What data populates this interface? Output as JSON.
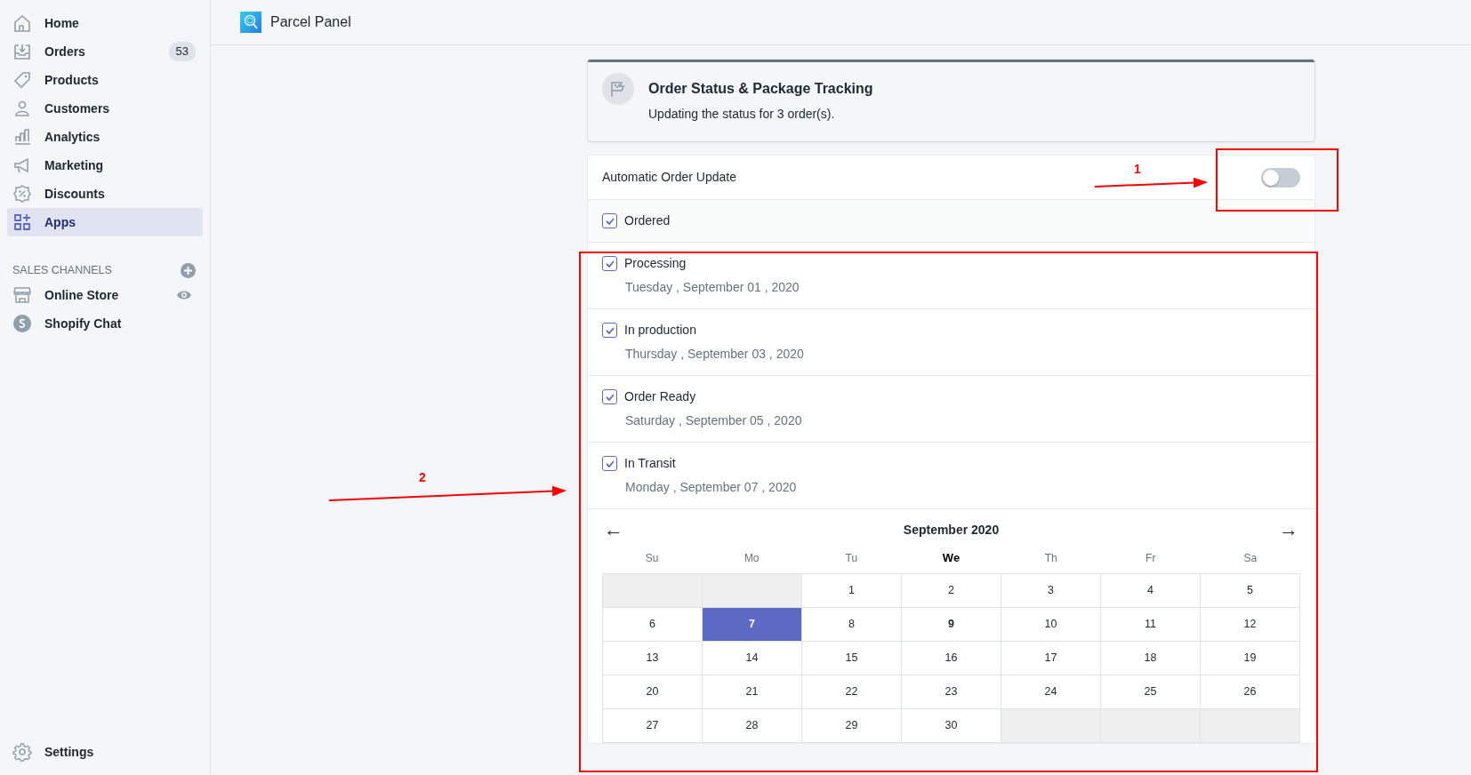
{
  "sidebar": {
    "items": [
      {
        "label": "Home",
        "selected": false
      },
      {
        "label": "Orders",
        "selected": false,
        "badge": "53"
      },
      {
        "label": "Products",
        "selected": false
      },
      {
        "label": "Customers",
        "selected": false
      },
      {
        "label": "Analytics",
        "selected": false
      },
      {
        "label": "Marketing",
        "selected": false
      },
      {
        "label": "Discounts",
        "selected": false
      },
      {
        "label": "Apps",
        "selected": true
      }
    ],
    "section_heading": "SALES CHANNELS",
    "channels": [
      {
        "label": "Online Store"
      },
      {
        "label": "Shopify Chat"
      }
    ],
    "settings": {
      "label": "Settings"
    }
  },
  "topbar": {
    "app_name": "Parcel Panel"
  },
  "header_card": {
    "title": "Order Status & Package Tracking",
    "subtitle": "Updating the status for 3 order(s)."
  },
  "automatic_update": {
    "label": "Automatic Order Update",
    "on": false
  },
  "statuses": [
    {
      "label": "Ordered",
      "checked": true
    },
    {
      "label": "Processing",
      "checked": true,
      "date": "Tuesday , September 01 , 2020"
    },
    {
      "label": "In production",
      "checked": true,
      "date": "Thursday , September 03 , 2020"
    },
    {
      "label": "Order Ready",
      "checked": true,
      "date": "Saturday , September 05 , 2020"
    },
    {
      "label": "In Transit",
      "checked": true,
      "date": "Monday , September 07 , 2020"
    }
  ],
  "calendar": {
    "prev": "←",
    "next": "→",
    "month": "September 2020",
    "weekdays": [
      {
        "label": "Su",
        "current": false
      },
      {
        "label": "Mo",
        "current": false
      },
      {
        "label": "Tu",
        "current": false
      },
      {
        "label": "We",
        "current": true
      },
      {
        "label": "Th",
        "current": false
      },
      {
        "label": "Fr",
        "current": false
      },
      {
        "label": "Sa",
        "current": false
      }
    ],
    "weeks": [
      [
        {
          "kind": "blank"
        },
        {
          "kind": "blank"
        },
        {
          "kind": "day",
          "label": "1",
          "selected": false,
          "today": false
        },
        {
          "kind": "day",
          "label": "2",
          "selected": false,
          "today": false
        },
        {
          "kind": "day",
          "label": "3",
          "selected": false,
          "today": false
        },
        {
          "kind": "day",
          "label": "4",
          "selected": false,
          "today": false
        },
        {
          "kind": "day",
          "label": "5",
          "selected": false,
          "today": false
        }
      ],
      [
        {
          "kind": "day",
          "label": "6",
          "selected": false,
          "today": false
        },
        {
          "kind": "day",
          "label": "7",
          "selected": true,
          "today": false
        },
        {
          "kind": "day",
          "label": "8",
          "selected": false,
          "today": false
        },
        {
          "kind": "day",
          "label": "9",
          "selected": false,
          "today": true
        },
        {
          "kind": "day",
          "label": "10",
          "selected": false,
          "today": false
        },
        {
          "kind": "day",
          "label": "11",
          "selected": false,
          "today": false
        },
        {
          "kind": "day",
          "label": "12",
          "selected": false,
          "today": false
        }
      ],
      [
        {
          "kind": "day",
          "label": "13",
          "selected": false,
          "today": false
        },
        {
          "kind": "day",
          "label": "14",
          "selected": false,
          "today": false
        },
        {
          "kind": "day",
          "label": "15",
          "selected": false,
          "today": false
        },
        {
          "kind": "day",
          "label": "16",
          "selected": false,
          "today": false
        },
        {
          "kind": "day",
          "label": "17",
          "selected": false,
          "today": false
        },
        {
          "kind": "day",
          "label": "18",
          "selected": false,
          "today": false
        },
        {
          "kind": "day",
          "label": "19",
          "selected": false,
          "today": false
        }
      ],
      [
        {
          "kind": "day",
          "label": "20",
          "selected": false,
          "today": false
        },
        {
          "kind": "day",
          "label": "21",
          "selected": false,
          "today": false
        },
        {
          "kind": "day",
          "label": "22",
          "selected": false,
          "today": false
        },
        {
          "kind": "day",
          "label": "23",
          "selected": false,
          "today": false
        },
        {
          "kind": "day",
          "label": "24",
          "selected": false,
          "today": false
        },
        {
          "kind": "day",
          "label": "25",
          "selected": false,
          "today": false
        },
        {
          "kind": "day",
          "label": "26",
          "selected": false,
          "today": false
        }
      ],
      [
        {
          "kind": "day",
          "label": "27",
          "selected": false,
          "today": false
        },
        {
          "kind": "day",
          "label": "28",
          "selected": false,
          "today": false
        },
        {
          "kind": "day",
          "label": "29",
          "selected": false,
          "today": false
        },
        {
          "kind": "day",
          "label": "30",
          "selected": false,
          "today": false
        },
        {
          "kind": "blank"
        },
        {
          "kind": "blank"
        },
        {
          "kind": "blank"
        }
      ]
    ]
  },
  "annotations": [
    {
      "label": "1"
    },
    {
      "label": "2"
    }
  ]
}
